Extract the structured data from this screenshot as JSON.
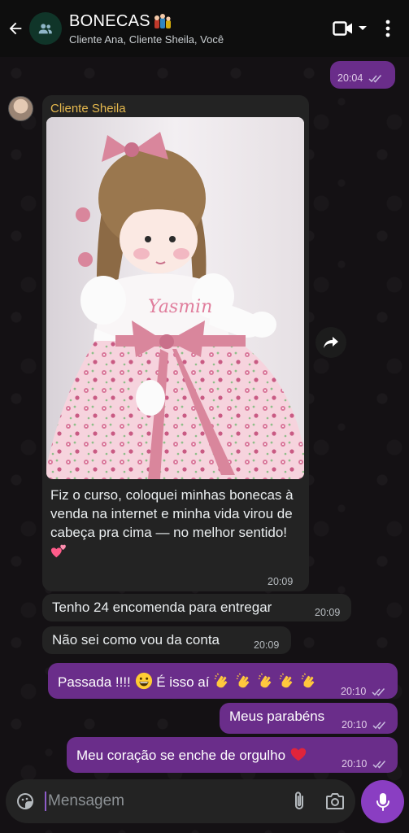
{
  "header": {
    "title": "BONECAS",
    "subtitle": "Cliente Ana, Cliente Sheila, Você",
    "icons": [
      "back-arrow-icon",
      "group-avatar-icon",
      "video-call-icon",
      "dropdown-icon",
      "more-vert-icon"
    ]
  },
  "messages": [
    {
      "type": "out",
      "time": "20:04",
      "status": "read"
    },
    {
      "type": "in-image",
      "sender": "Cliente Sheila",
      "caption": "Fiz o curso, coloquei minhas bonecas à venda na internet e minha vida virou de cabeça pra cima — no melhor sentido!",
      "emoji": "two-hearts",
      "time": "20:09",
      "image_text": "Yasmin"
    },
    {
      "type": "in",
      "text": "Tenho 24 encomenda para entregar",
      "time": "20:09"
    },
    {
      "type": "in",
      "text": "Não sei como vou da conta",
      "time": "20:09"
    },
    {
      "type": "out",
      "text": "Passada !!!!",
      "text2": "É isso aí",
      "emojis": [
        "grinning-face",
        "clapping-hands x5"
      ],
      "time": "20:10",
      "status": "read"
    },
    {
      "type": "out",
      "text": "Meus parabéns",
      "time": "20:10",
      "status": "read"
    },
    {
      "type": "out",
      "text": "Meu coração se enche de orgulho",
      "emoji": "red-heart",
      "time": "20:10",
      "status": "read"
    }
  ],
  "composer": {
    "placeholder": "Mensagem"
  },
  "colors": {
    "header_bg": "#0e0e0e",
    "incoming_bubble": "#232323",
    "outgoing_bubble": "#6a2d8a",
    "sender_name": "#e6b94e",
    "mic_button": "#8a3ec2"
  }
}
